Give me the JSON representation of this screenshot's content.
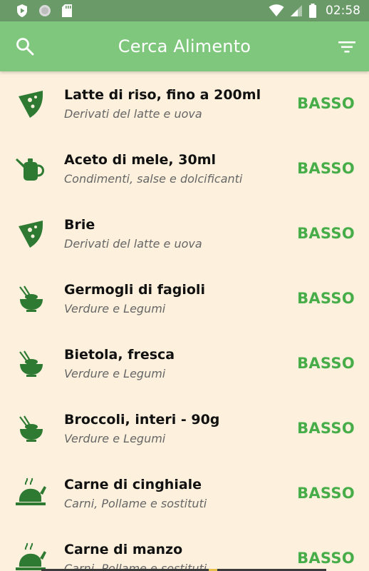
{
  "status_bar": {
    "time": "02:58",
    "icons": [
      "play-protect-icon",
      "circle-icon",
      "sd-card-icon",
      "wifi-icon",
      "signal-icon",
      "battery-icon"
    ]
  },
  "app_bar": {
    "title": "Cerca Alimento",
    "search_icon": "search-icon",
    "filter_icon": "filter-icon",
    "color": "#7fc77c"
  },
  "colors": {
    "level": "#46ad49",
    "icon": "#2e7a33",
    "background": "#fdf1dd"
  },
  "foods": [
    {
      "name": "Latte di riso, fino a 200ml",
      "category": "Derivati del latte e uova",
      "level": "BASSO",
      "icon": "cheese-icon"
    },
    {
      "name": "Aceto di mele, 30ml",
      "category": "Condimenti, salse e dolcificanti",
      "level": "BASSO",
      "icon": "teapot-icon"
    },
    {
      "name": "Brie",
      "category": "Derivati del latte e uova",
      "level": "BASSO",
      "icon": "cheese-icon"
    },
    {
      "name": "Germogli di fagioli",
      "category": "Verdure e Legumi",
      "level": "BASSO",
      "icon": "bowl-icon"
    },
    {
      "name": "Bietola, fresca",
      "category": "Verdure e Legumi",
      "level": "BASSO",
      "icon": "bowl-icon"
    },
    {
      "name": "Broccoli, interi - 90g",
      "category": "Verdure e Legumi",
      "level": "BASSO",
      "icon": "bowl-icon"
    },
    {
      "name": "Carne di cinghiale",
      "category": "Carni, Pollame e sostituti",
      "level": "BASSO",
      "icon": "roast-icon"
    },
    {
      "name": "Carne di manzo",
      "category": "Carni, Pollame e sostituti",
      "level": "BASSO",
      "icon": "roast-icon"
    }
  ]
}
